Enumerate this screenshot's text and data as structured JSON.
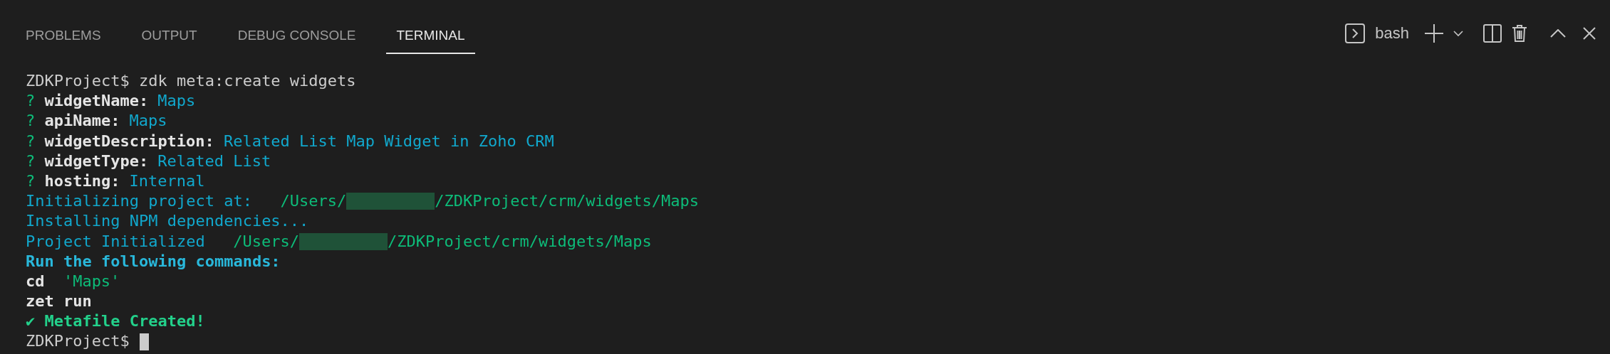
{
  "tabs": [
    {
      "label": "PROBLEMS",
      "selected": false
    },
    {
      "label": "OUTPUT",
      "selected": false
    },
    {
      "label": "DEBUG CONSOLE",
      "selected": false
    },
    {
      "label": "TERMINAL",
      "selected": true
    }
  ],
  "toolbar": {
    "shell": "bash"
  },
  "terminal": {
    "cursor": true,
    "lines": [
      {
        "segments": [
          {
            "kind": "plain",
            "text": "ZDKProject$ zdk meta:create widgets"
          }
        ]
      },
      {
        "segments": [
          {
            "kind": "question",
            "text": "?"
          },
          {
            "kind": "bold",
            "text": "widgetName:"
          },
          {
            "kind": "cyan",
            "text": "Maps"
          }
        ]
      },
      {
        "segments": [
          {
            "kind": "question",
            "text": "?"
          },
          {
            "kind": "bold",
            "text": "apiName:"
          },
          {
            "kind": "cyan",
            "text": "Maps"
          }
        ]
      },
      {
        "segments": [
          {
            "kind": "question",
            "text": "?"
          },
          {
            "kind": "bold",
            "text": "widgetDescription:"
          },
          {
            "kind": "cyan",
            "text": "Related List Map Widget in Zoho CRM"
          }
        ]
      },
      {
        "segments": [
          {
            "kind": "question",
            "text": "?"
          },
          {
            "kind": "bold",
            "text": "widgetType:"
          },
          {
            "kind": "cyan",
            "text": "Related List"
          }
        ]
      },
      {
        "segments": [
          {
            "kind": "question",
            "text": "?"
          },
          {
            "kind": "bold",
            "text": "hosting:"
          },
          {
            "kind": "cyan",
            "text": "Internal"
          }
        ]
      },
      {
        "segments": [
          {
            "kind": "cyan",
            "text": "Initializing project at:"
          },
          {
            "kind": "green",
            "text": "/Users/"
          },
          {
            "kind": "redacted"
          },
          {
            "kind": "green",
            "text": "/ZDKProject/crm/widgets/Maps"
          }
        ]
      },
      {
        "segments": [
          {
            "kind": "cyan",
            "text": "Installing NPM dependencies..."
          }
        ]
      },
      {
        "segments": [
          {
            "kind": "cyan",
            "text": "Project Initialized"
          },
          {
            "kind": "green",
            "text": "/Users/"
          },
          {
            "kind": "redacted"
          },
          {
            "kind": "green",
            "text": "/ZDKProject/crm/widgets/Maps"
          }
        ]
      },
      {
        "segments": [
          {
            "kind": "boldcyan",
            "text": "Run the following commands:"
          }
        ]
      },
      {
        "segments": [
          {
            "kind": "bold",
            "text": "cd"
          },
          {
            "kind": "green",
            "text": "'Maps'"
          }
        ]
      },
      {
        "segments": [
          {
            "kind": "bold",
            "text": "zet run"
          }
        ]
      },
      {
        "segments": [
          {
            "kind": "boldgreen",
            "text": "✔ Metafile Created!"
          }
        ]
      },
      {
        "segments": [
          {
            "kind": "plain",
            "text": "ZDKProject$"
          }
        ]
      }
    ]
  }
}
